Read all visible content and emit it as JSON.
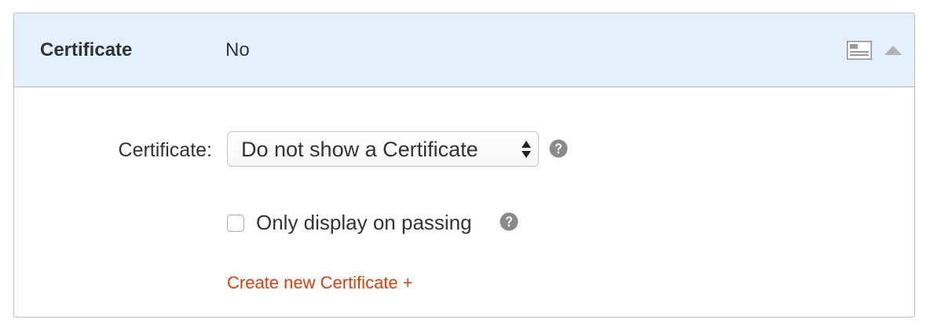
{
  "header": {
    "title": "Certificate",
    "value": "No",
    "icons": [
      "settings-card-icon",
      "collapse-triangle-icon"
    ]
  },
  "certificate_field": {
    "label": "Certificate:",
    "selected_value": "Do not show a Certificate",
    "help_icon": "question-circle-icon"
  },
  "passing_option": {
    "label": "Only display on passing",
    "checked": false,
    "help_icon": "question-circle-icon"
  },
  "create_link": {
    "label": "Create new Certificate +"
  },
  "colors": {
    "header_bg": "#e4f1fd",
    "link": "#d8400c",
    "text": "#333333",
    "help_icon": "#8a8a8a"
  }
}
